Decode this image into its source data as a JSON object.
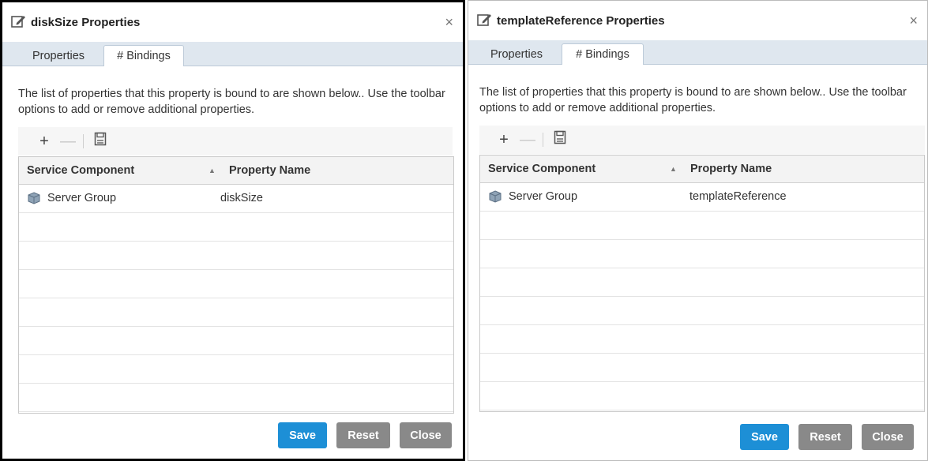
{
  "dialogs": [
    {
      "title": "diskSize Properties",
      "close_glyph": "×",
      "tabs": [
        "Properties",
        "# Bindings"
      ],
      "active_tab": "# Bindings",
      "description": "The list of properties that this property is bound to are shown below.. Use the toolbar options to add or remove additional properties.",
      "toolbar": {
        "add": "+",
        "remove": "—",
        "save_icon": "save-icon"
      },
      "grid": {
        "columns": [
          "Service Component",
          "Property Name"
        ],
        "sort_indicator": "▲",
        "rows": [
          {
            "component": "Server Group",
            "property": "diskSize",
            "icon": "server-group-icon"
          }
        ]
      },
      "buttons": {
        "save": "Save",
        "reset": "Reset",
        "close": "Close"
      }
    },
    {
      "title": "templateReference Properties",
      "close_glyph": "×",
      "tabs": [
        "Properties",
        "# Bindings"
      ],
      "active_tab": "# Bindings",
      "description": "The list of properties that this property is bound to are shown below.. Use the toolbar options to add or remove additional properties.",
      "toolbar": {
        "add": "+",
        "remove": "—",
        "save_icon": "save-icon"
      },
      "grid": {
        "columns": [
          "Service Component",
          "Property Name"
        ],
        "sort_indicator": "▲",
        "rows": [
          {
            "component": "Server Group",
            "property": "templateReference",
            "icon": "server-group-icon"
          }
        ]
      },
      "buttons": {
        "save": "Save",
        "reset": "Reset",
        "close": "Close"
      }
    }
  ],
  "colors": {
    "primary_button": "#1d8fd6",
    "secondary_button": "#898989",
    "tab_strip": "#dfe7ef",
    "grid_header": "#f3f3f3"
  }
}
